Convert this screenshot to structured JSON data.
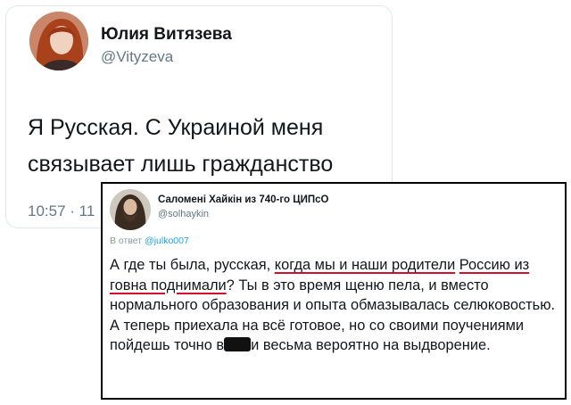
{
  "tweet1": {
    "author_name": "Юлия Витязева",
    "handle": "@Vityzeva",
    "text_line1": "Я Русская. С Украиной меня",
    "text_line2": "связывает лишь гражданство",
    "time": "10:57 · 11"
  },
  "tweet2": {
    "author_name": "Саломені Хайкін из 740-го ЦИПсО",
    "handle": "@solhaykin",
    "reply_prefix": "В ответ",
    "reply_mention": "@julko007",
    "text": {
      "part1": "А где ты была, русская, ",
      "underlined1": "когда мы и наши родители",
      "underlined2": "Россию из говна поднимали",
      "part2": "? Ты в это время щеню пела, и вместо нормального образования и опыта обмазывалась селюковостью. А теперь приехала на всё готовое, но со своими поучениями пойдешь точно в",
      "part3": "и весьма вероятно на выдворение."
    }
  },
  "colors": {
    "underline": "#d0112b",
    "secondary_text": "#657786",
    "mention": "#1da1f2",
    "border": "#000000"
  }
}
